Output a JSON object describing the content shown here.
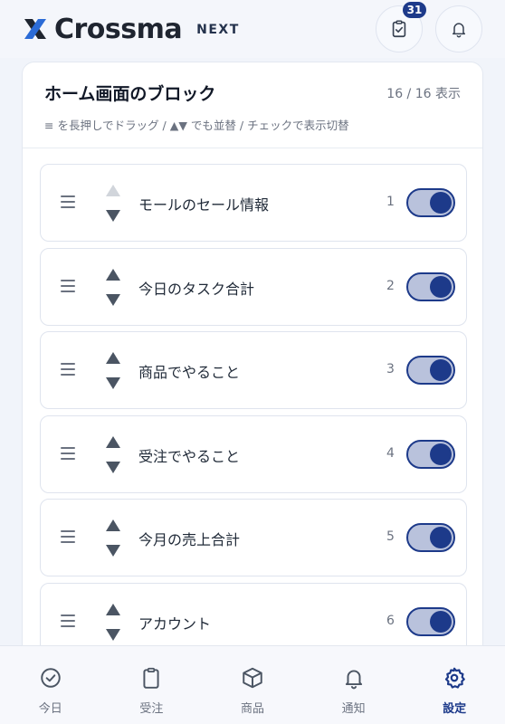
{
  "header": {
    "brand": "Crossma",
    "brand_suffix": "NEXT",
    "task_badge": "31",
    "logo_mark_icon": "x-logo-icon",
    "colors": {
      "accent": "#1d3a8a",
      "logo_blue": "#2b6bd6"
    }
  },
  "card": {
    "title": "ホーム画面のブロック",
    "count": "16 / 16 表示",
    "hint": "≡ を長押しでドラッグ / ▲▼ でも並替 / チェックで表示切替"
  },
  "blocks": [
    {
      "label": "モールのセール情報",
      "order": "1",
      "enabled": true,
      "up_disabled": true
    },
    {
      "label": "今日のタスク合計",
      "order": "2",
      "enabled": true,
      "up_disabled": false
    },
    {
      "label": "商品でやること",
      "order": "3",
      "enabled": true,
      "up_disabled": false
    },
    {
      "label": "受注でやること",
      "order": "4",
      "enabled": true,
      "up_disabled": false
    },
    {
      "label": "今月の売上合計",
      "order": "5",
      "enabled": true,
      "up_disabled": false
    },
    {
      "label": "アカウント",
      "order": "6",
      "enabled": true,
      "up_disabled": false
    }
  ],
  "bottom_nav": [
    {
      "label": "今日",
      "icon": "check-circle-icon",
      "active": false
    },
    {
      "label": "受注",
      "icon": "clipboard-icon",
      "active": false
    },
    {
      "label": "商品",
      "icon": "box-icon",
      "active": false
    },
    {
      "label": "通知",
      "icon": "bell-icon",
      "active": false
    },
    {
      "label": "設定",
      "icon": "gear-icon",
      "active": true
    }
  ]
}
